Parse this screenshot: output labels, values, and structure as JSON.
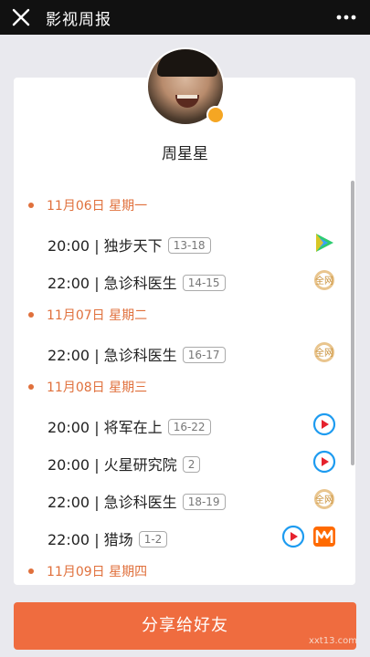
{
  "header": {
    "title": "影视周报",
    "close_icon": "close-icon",
    "more_icon": "more-dots-icon"
  },
  "profile": {
    "name": "周星星",
    "avatar_icon": "avatar-photo",
    "badge_icon": "verified-badge-icon"
  },
  "schedule": [
    {
      "date": "11月06日 星期一",
      "shows": [
        {
          "time": "20:00",
          "name": "独步天下",
          "episodes": "13-18",
          "platforms": [
            "tencent-video-icon"
          ]
        },
        {
          "time": "22:00",
          "name": "急诊科医生",
          "episodes": "14-15",
          "platforms": [
            "all-network-icon"
          ]
        }
      ]
    },
    {
      "date": "11月07日 星期二",
      "shows": [
        {
          "time": "22:00",
          "name": "急诊科医生",
          "episodes": "16-17",
          "platforms": [
            "all-network-icon"
          ]
        }
      ]
    },
    {
      "date": "11月08日 星期三",
      "shows": [
        {
          "time": "20:00",
          "name": "将军在上",
          "episodes": "16-22",
          "platforms": [
            "youku-icon"
          ]
        },
        {
          "time": "20:00",
          "name": "火星研究院",
          "episodes": "2",
          "platforms": [
            "youku-icon"
          ]
        },
        {
          "time": "22:00",
          "name": "急诊科医生",
          "episodes": "18-19",
          "platforms": [
            "all-network-icon"
          ]
        },
        {
          "time": "22:00",
          "name": "猎场",
          "episodes": "1-2",
          "platforms": [
            "youku-icon",
            "mango-tv-icon"
          ]
        }
      ]
    },
    {
      "date": "11月09日 星期四",
      "shows": []
    }
  ],
  "footer": {
    "share_label": "分享给好友",
    "watermark": "xxt13.com"
  },
  "colors": {
    "accent": "#ef6c3f",
    "date": "#e0703c",
    "topbar": "#111111",
    "badge": "#f5a623"
  }
}
